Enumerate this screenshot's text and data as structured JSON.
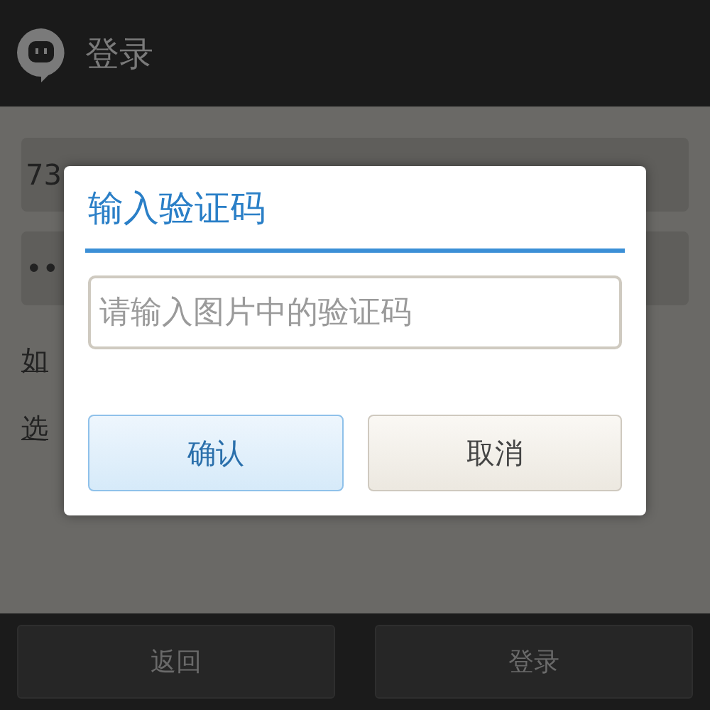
{
  "header": {
    "title": "登录"
  },
  "login_form": {
    "account_value": "73",
    "password_value": "••",
    "link_1": "如",
    "link_2": "选"
  },
  "bottom_bar": {
    "buttons": [
      "返回",
      "登录"
    ]
  },
  "dialog": {
    "title": "输入验证码",
    "placeholder": "请输入图片中的验证码",
    "buttons": [
      {
        "label": "确认",
        "kind": "primary"
      },
      {
        "label": "取消",
        "kind": "secondary"
      }
    ]
  }
}
